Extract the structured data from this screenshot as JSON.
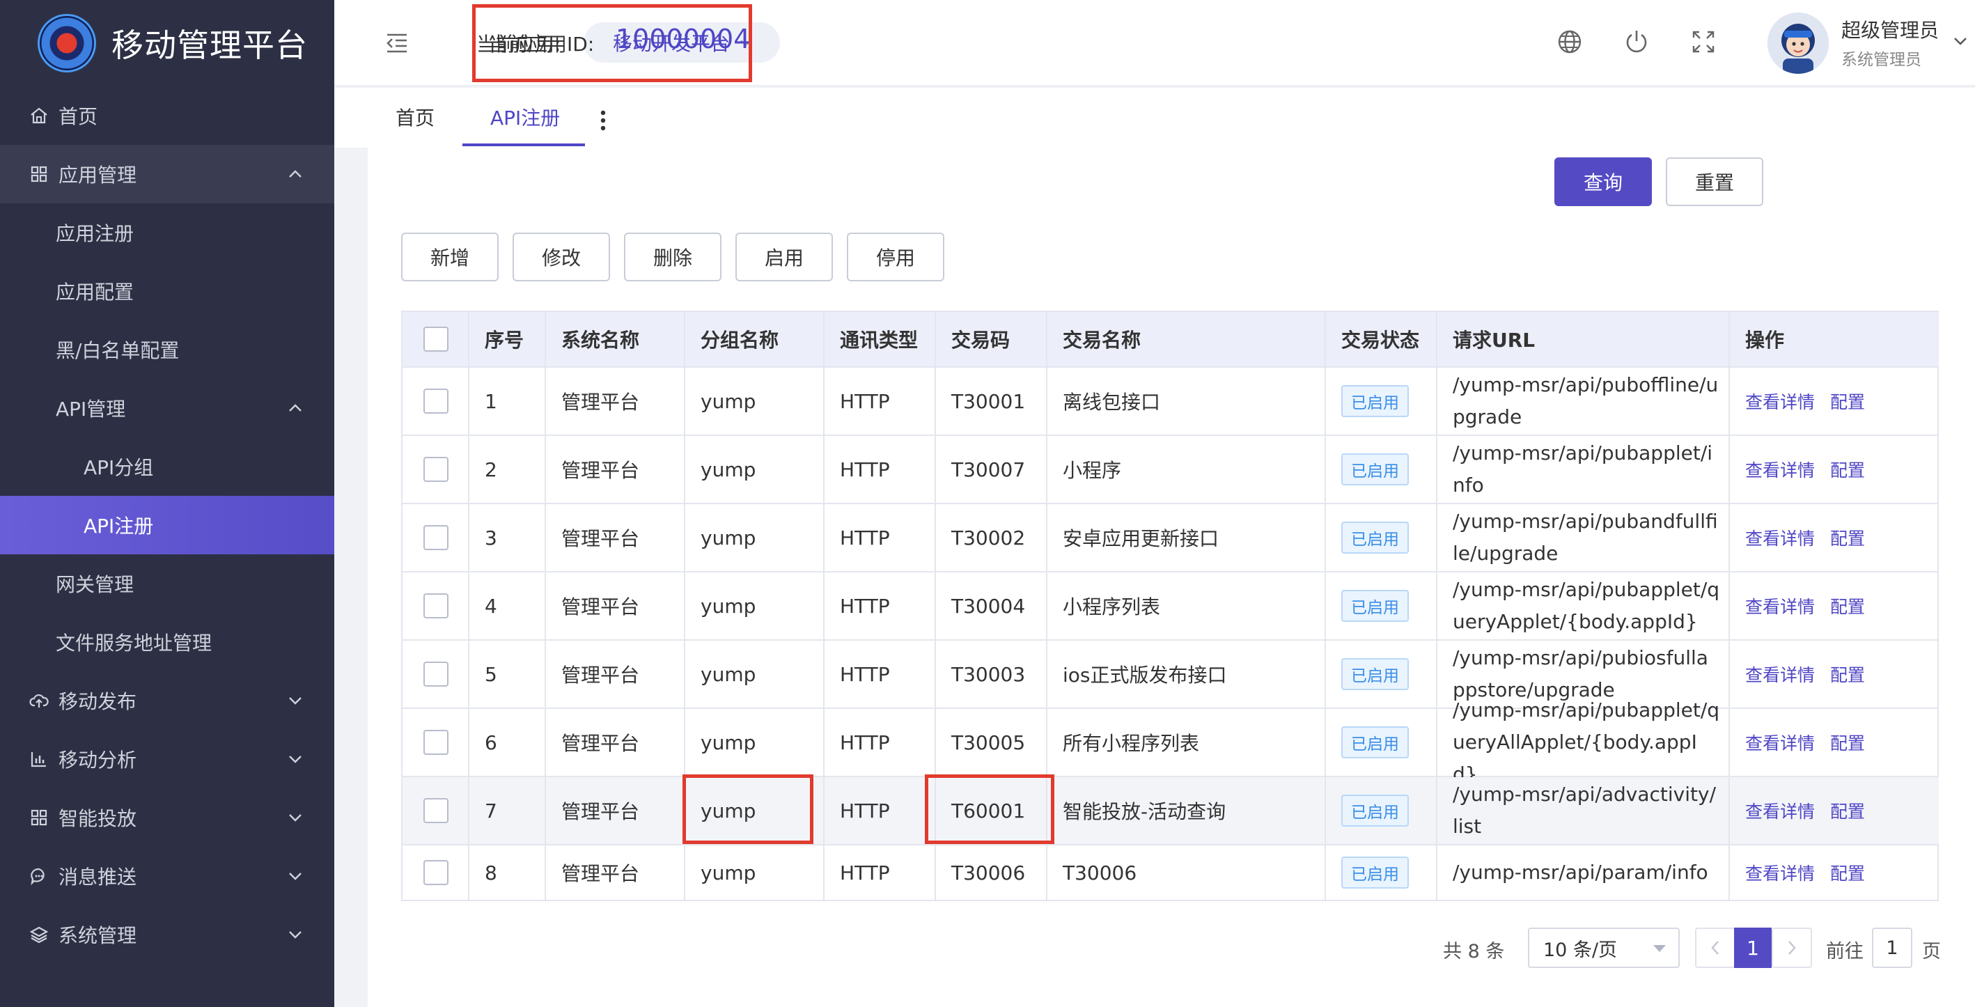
{
  "app_title": "移动管理平台",
  "sidebar": {
    "items": [
      {
        "label": "首页",
        "icon": "home-icon",
        "level": 0
      },
      {
        "label": "应用管理",
        "icon": "grid-icon",
        "level": 0,
        "open": true
      },
      {
        "label": "应用注册",
        "level": 1
      },
      {
        "label": "应用配置",
        "level": 1
      },
      {
        "label": "黑/白名单配置",
        "level": 1
      },
      {
        "label": "API管理",
        "level": 1,
        "open": true
      },
      {
        "label": "API分组",
        "level": 2
      },
      {
        "label": "API注册",
        "level": 2,
        "active": true
      },
      {
        "label": "网关管理",
        "level": 1
      },
      {
        "label": "文件服务地址管理",
        "level": 1
      },
      {
        "label": "移动发布",
        "icon": "cloud-upload-icon",
        "level": 0
      },
      {
        "label": "移动分析",
        "icon": "bar-chart-icon",
        "level": 0
      },
      {
        "label": "智能投放",
        "icon": "grid-icon",
        "level": 0
      },
      {
        "label": "消息推送",
        "icon": "chat-icon",
        "level": 0
      },
      {
        "label": "系统管理",
        "icon": "layers-icon",
        "level": 0
      }
    ]
  },
  "header": {
    "current_app_label": "当前应用:",
    "current_app_value": "移动开发平台",
    "current_app_id_label": "当前应用ID:",
    "current_app_id_value": "10000004",
    "user_name": "超级管理员",
    "user_role": "系统管理员"
  },
  "tabs": [
    {
      "label": "首页"
    },
    {
      "label": "API注册",
      "active": true
    }
  ],
  "toolbar": {
    "query": "查询",
    "reset": "重置",
    "add": "新增",
    "edit": "修改",
    "delete": "删除",
    "enable": "启用",
    "disable": "停用"
  },
  "table": {
    "headers": [
      "序号",
      "系统名称",
      "分组名称",
      "通讯类型",
      "交易码",
      "交易名称",
      "交易状态",
      "请求URL",
      "操作"
    ],
    "rows": [
      {
        "no": "1",
        "system": "管理平台",
        "group": "yump",
        "protocol": "HTTP",
        "code": "T30001",
        "name": "离线包接口",
        "status": "已启用",
        "url": "/yump-msr/api/puboffline/upgrade"
      },
      {
        "no": "2",
        "system": "管理平台",
        "group": "yump",
        "protocol": "HTTP",
        "code": "T30007",
        "name": "小程序",
        "status": "已启用",
        "url": "/yump-msr/api/pubapplet/info"
      },
      {
        "no": "3",
        "system": "管理平台",
        "group": "yump",
        "protocol": "HTTP",
        "code": "T30002",
        "name": "安卓应用更新接口",
        "status": "已启用",
        "url": "/yump-msr/api/pubandfullfile/upgrade"
      },
      {
        "no": "4",
        "system": "管理平台",
        "group": "yump",
        "protocol": "HTTP",
        "code": "T30004",
        "name": "小程序列表",
        "status": "已启用",
        "url": "/yump-msr/api/pubapplet/queryApplet/{body.appId}"
      },
      {
        "no": "5",
        "system": "管理平台",
        "group": "yump",
        "protocol": "HTTP",
        "code": "T30003",
        "name": "ios正式版发布接口",
        "status": "已启用",
        "url": "/yump-msr/api/pubiosfullappstore/upgrade"
      },
      {
        "no": "6",
        "system": "管理平台",
        "group": "yump",
        "protocol": "HTTP",
        "code": "T30005",
        "name": "所有小程序列表",
        "status": "已启用",
        "url": "/yump-msr/api/pubapplet/queryAllApplet/{body.appId}"
      },
      {
        "no": "7",
        "system": "管理平台",
        "group": "yump",
        "protocol": "HTTP",
        "code": "T60001",
        "name": "智能投放-活动查询",
        "status": "已启用",
        "url": "/yump-msr/api/advactivity/list"
      },
      {
        "no": "8",
        "system": "管理平台",
        "group": "yump",
        "protocol": "HTTP",
        "code": "T30006",
        "name": "T30006",
        "status": "已启用",
        "url": "/yump-msr/api/param/info"
      }
    ],
    "op_detail": "查看详情",
    "op_config": "配置"
  },
  "pagination": {
    "total": "共 8 条",
    "page_size": "10 条/页",
    "current_page": "1",
    "goto_label": "前往",
    "goto_value": "1",
    "page_unit": "页"
  }
}
